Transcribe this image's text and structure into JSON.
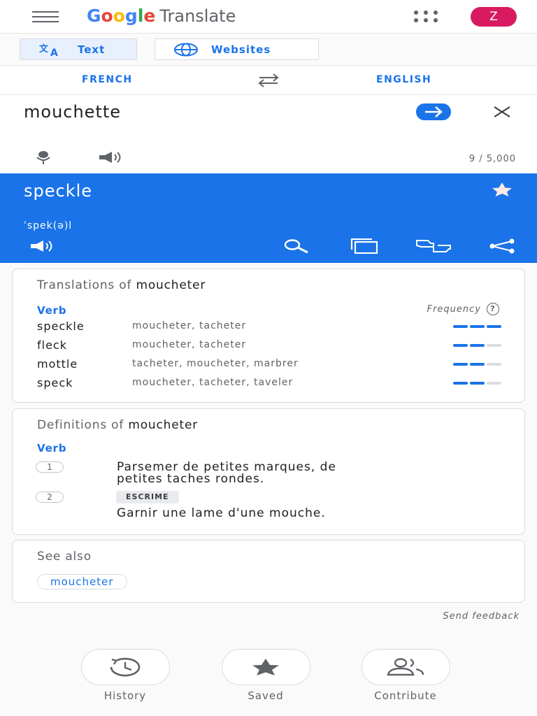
{
  "header": {
    "app_name": "Translate",
    "logo_letters": [
      "G",
      "o",
      "o",
      "g",
      "l",
      "e"
    ],
    "logo_colors": [
      "#4285f4",
      "#ea4335",
      "#fbbc05",
      "#4285f4",
      "#34a853",
      "#ea4335"
    ],
    "avatar_initial": "Z",
    "avatar_color": "#d81b60"
  },
  "modes": {
    "text_label": "Text",
    "websites_label": "Websites"
  },
  "languages": {
    "source": "FRENCH",
    "target": "ENGLISH"
  },
  "input": {
    "text": "mouchette",
    "char_count": "9 / 5,000"
  },
  "output": {
    "text": "speckle",
    "phonetic": "ˈspek(ə)l"
  },
  "translations": {
    "title_prefix": "Translations of ",
    "word": "moucheter",
    "pos": "Verb",
    "frequency_label": "Frequency",
    "help_glyph": "?",
    "rows": [
      {
        "word": "speckle",
        "synonyms": "moucheter, tacheter",
        "frequency": 3
      },
      {
        "word": "fleck",
        "synonyms": "moucheter, tacheter",
        "frequency": 2
      },
      {
        "word": "mottle",
        "synonyms": "tacheter, moucheter, marbrer",
        "frequency": 2
      },
      {
        "word": "speck",
        "synonyms": "moucheter, tacheter, taveler",
        "frequency": 2
      }
    ]
  },
  "definitions": {
    "title_prefix": "Definitions of ",
    "word": "moucheter",
    "pos": "Verb",
    "items": [
      {
        "num": "1",
        "text_line1": "Parsemer de petites marques, de",
        "text_line2": "petites taches rondes."
      },
      {
        "num": "2",
        "tag": "ESCRIME",
        "text": "Garnir une lame d'une mouche."
      }
    ]
  },
  "see_also": {
    "title": "See also",
    "chips": [
      "moucheter"
    ]
  },
  "feedback": "Send feedback",
  "bottom_nav": {
    "history": "History",
    "saved": "Saved",
    "contribute": "Contribute"
  },
  "colors": {
    "accent": "#1a73e8",
    "inactive_bar": "#dadce0"
  }
}
